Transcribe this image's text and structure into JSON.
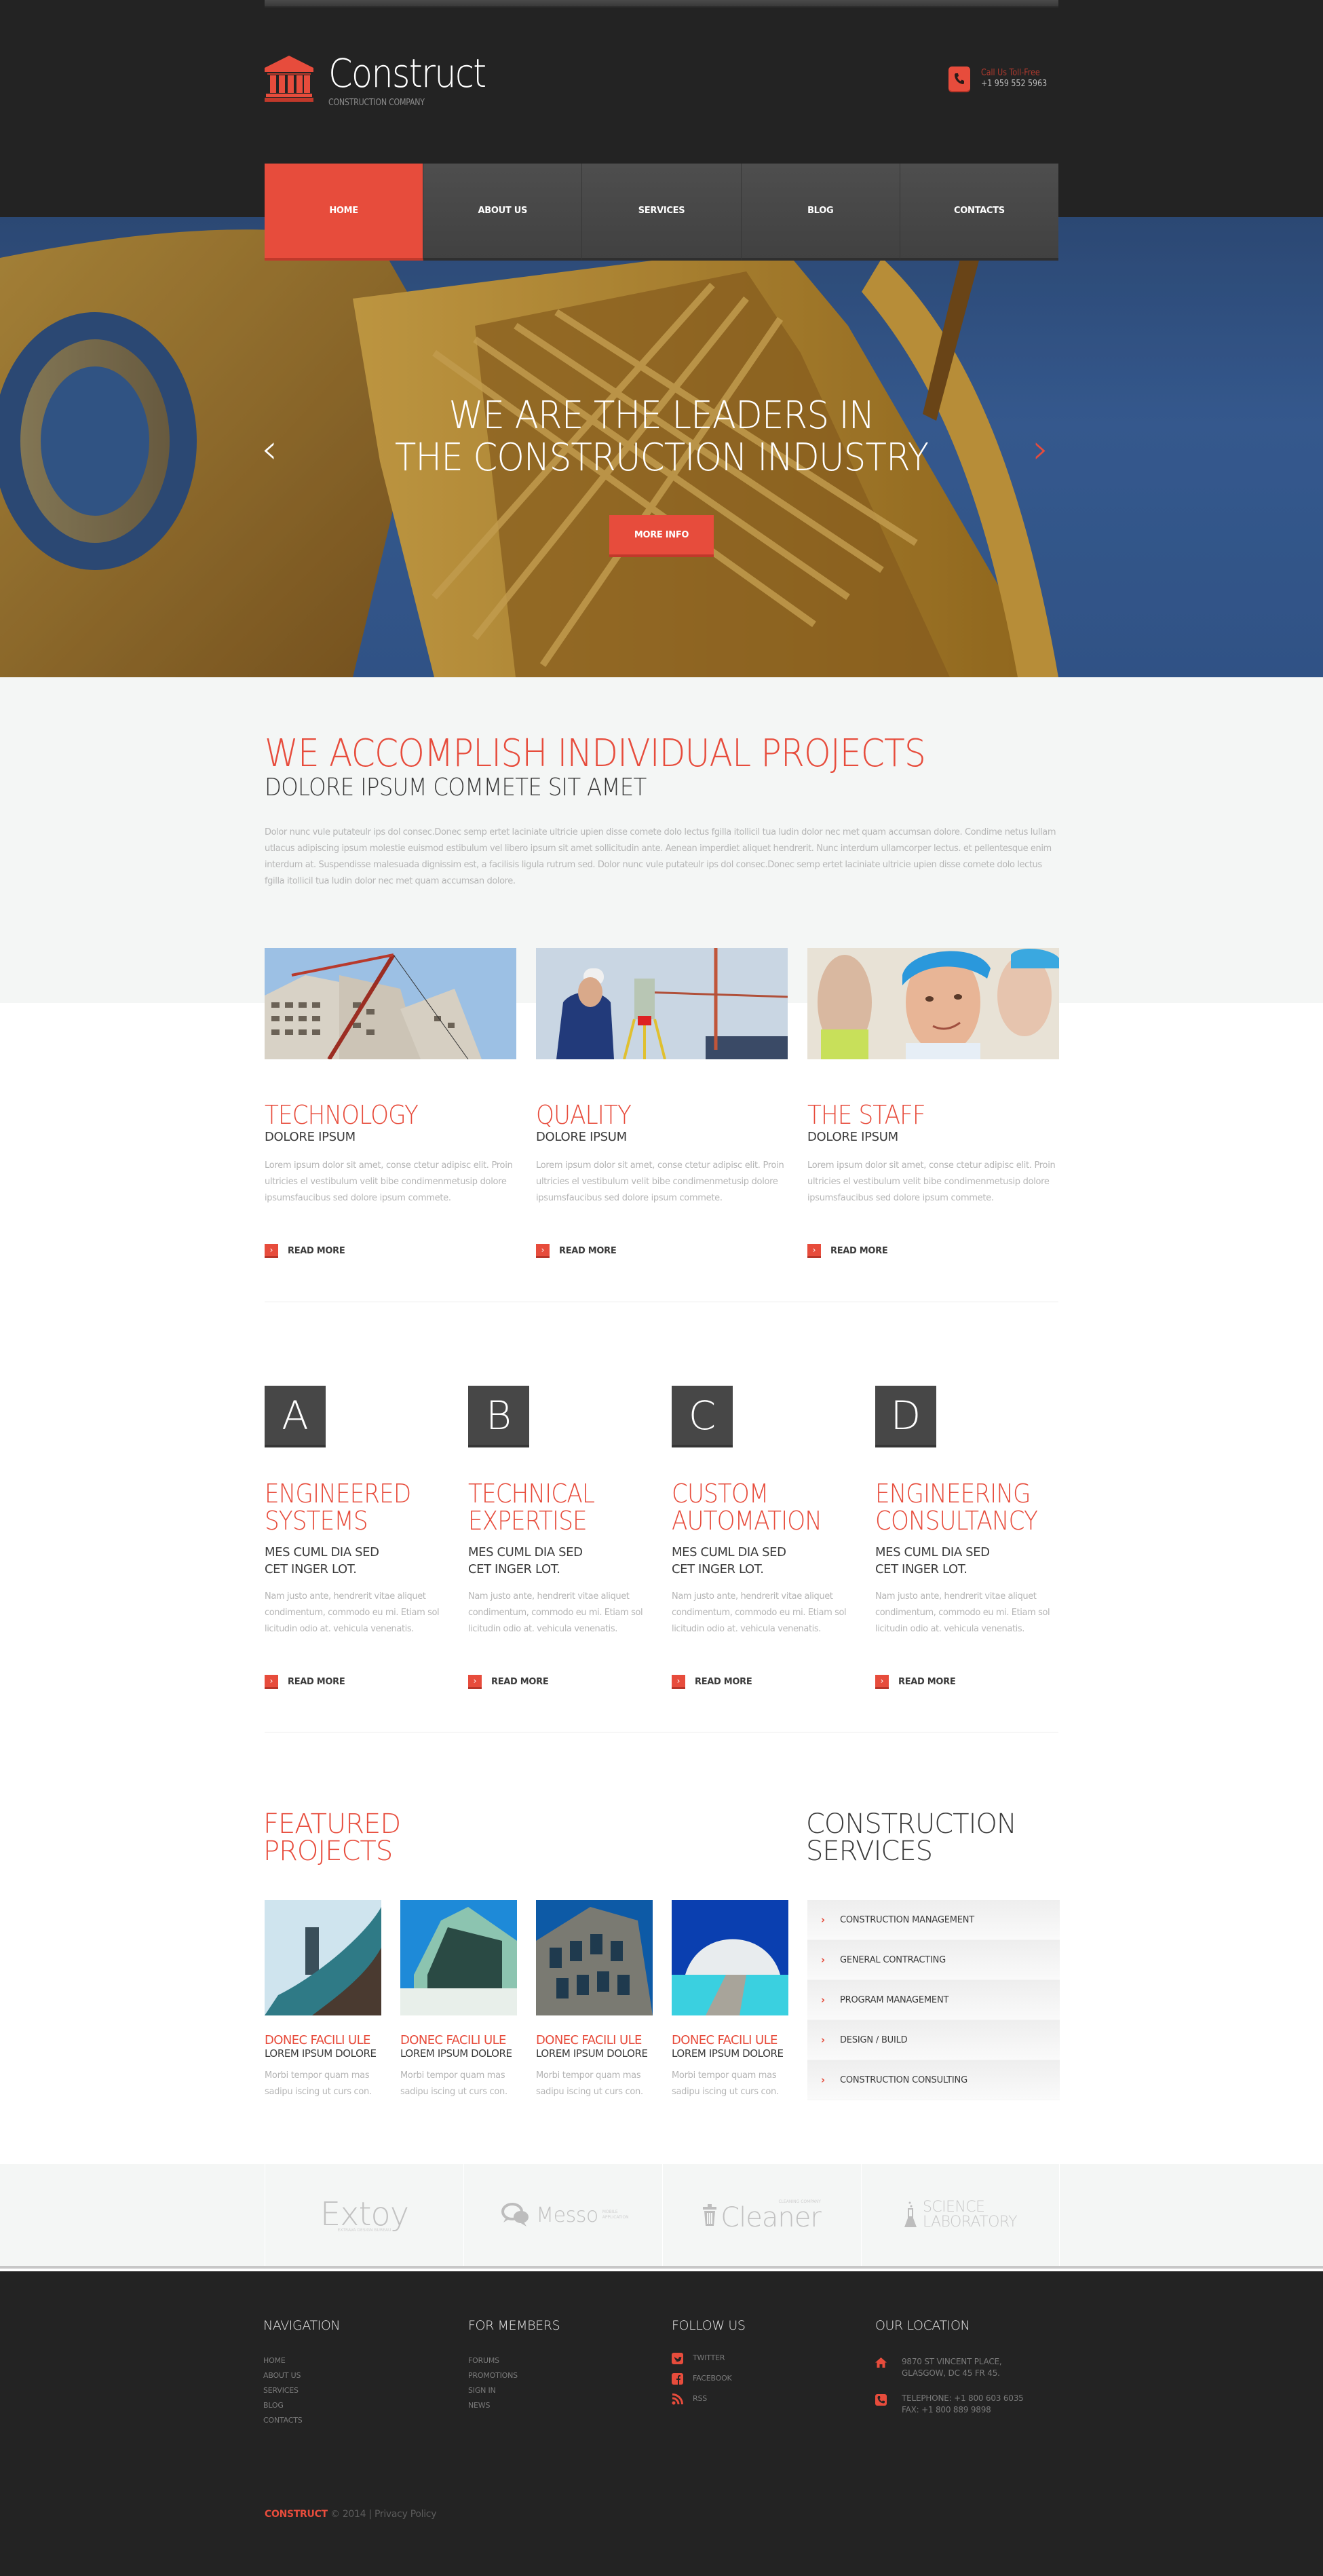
{
  "header": {
    "logo_title": "Construct",
    "logo_subtitle": "CONSTRUCTION COMPANY",
    "phone_label": "Call Us Toll-Free",
    "phone_number": "+1 959 552 5963"
  },
  "nav": {
    "items": [
      {
        "label": "HOME",
        "active": true
      },
      {
        "label": "ABOUT US"
      },
      {
        "label": "SERVICES"
      },
      {
        "label": "BLOG"
      },
      {
        "label": "CONTACTS"
      }
    ]
  },
  "hero": {
    "title_line1": "WE ARE THE LEADERS IN",
    "title_line2": "THE CONSTRUCTION INDUSTRY",
    "button_label": "MORE INFO",
    "prev_arrow": "‹",
    "next_arrow": "›"
  },
  "intro": {
    "title": "WE ACCOMPLISH INDIVIDUAL PROJECTS",
    "subtitle": "DOLORE IPSUM COMMETE SIT AMET",
    "text": "Dolor nunc vule putateulr ips dol consec.Donec semp ertet laciniate ultricie upien disse comete dolo lectus fgilla itollicil tua ludin dolor nec met quam accumsan dolore. Condime netus lullam utlacus adipiscing ipsum molestie euismod estibulum vel libero ipsum sit amet sollicitudin ante. Aenean imperdiet aliquet hendrerit. Nunc interdum ullamcorper lectus. et pellentesque enim interdum at. Suspendisse malesuada dignissim est, a facilisis ligula rutrum sed. Dolor nunc vule putateulr ips dol consec.Donec semp ertet laciniate ultricie upien disse comete dolo lectus fgilla itollicil tua ludin dolor nec met quam accumsan dolore."
  },
  "features": [
    {
      "title": "TECHNOLOGY",
      "subtitle": "DOLORE IPSUM",
      "text": "Lorem ipsum dolor sit amet, conse ctetur adipisc elit. Proin ultricies el vestibulum velit bibe condimenmetusip dolore ipsumsfaucibus sed dolore ipsum commete.",
      "link": "READ MORE"
    },
    {
      "title": "QUALITY",
      "subtitle": "DOLORE IPSUM",
      "text": "Lorem ipsum dolor sit amet, conse ctetur adipisc elit. Proin ultricies el vestibulum velit bibe condimenmetusip dolore ipsumsfaucibus sed dolore ipsum commete.",
      "link": "READ MORE"
    },
    {
      "title": "THE STAFF",
      "subtitle": "DOLORE IPSUM",
      "text": "Lorem ipsum dolor sit amet, conse ctetur adipisc elit. Proin ultricies el vestibulum velit bibe condimenmetusip dolore ipsumsfaucibus sed dolore ipsum commete.",
      "link": "READ MORE"
    }
  ],
  "services": [
    {
      "letter": "A",
      "title1": "ENGINEERED",
      "title2": "SYSTEMS",
      "sub1": "MES CUML DIA SED",
      "sub2": "CET INGER LOT.",
      "text": "Nam justo ante, hendrerit vitae aliquet condimentum, commodo eu mi. Etiam sol licitudin odio at. vehicula venenatis.",
      "link": "READ MORE"
    },
    {
      "letter": "B",
      "title1": "TECHNICAL",
      "title2": "EXPERTISE",
      "sub1": "MES CUML DIA SED",
      "sub2": "CET INGER LOT.",
      "text": "Nam justo ante, hendrerit vitae aliquet condimentum, commodo eu mi. Etiam sol licitudin odio at. vehicula venenatis.",
      "link": "READ MORE"
    },
    {
      "letter": "C",
      "title1": "CUSTOM",
      "title2": "AUTOMATION",
      "sub1": "MES CUML DIA SED",
      "sub2": "CET INGER LOT.",
      "text": "Nam justo ante, hendrerit vitae aliquet condimentum, commodo eu mi. Etiam sol licitudin odio at. vehicula venenatis.",
      "link": "READ MORE"
    },
    {
      "letter": "D",
      "title1": "ENGINEERING",
      "title2": "CONSULTANCY",
      "sub1": "MES CUML DIA SED",
      "sub2": "CET INGER LOT.",
      "text": "Nam justo ante, hendrerit vitae aliquet condimentum, commodo eu mi. Etiam sol licitudin odio at. vehicula venenatis.",
      "link": "READ MORE"
    }
  ],
  "featured": {
    "title1": "FEATURED",
    "title2": "PROJECTS",
    "projects": [
      {
        "title": "DONEC FACILI ULE",
        "subtitle": "LOREM IPSUM DOLORE",
        "text": "Morbi tempor quam mas sadipu iscing ut curs con."
      },
      {
        "title": "DONEC FACILI ULE",
        "subtitle": "LOREM IPSUM DOLORE",
        "text": "Morbi tempor quam mas sadipu iscing ut curs con."
      },
      {
        "title": "DONEC FACILI ULE",
        "subtitle": "LOREM IPSUM DOLORE",
        "text": "Morbi tempor quam mas sadipu iscing ut curs con."
      },
      {
        "title": "DONEC FACILI ULE",
        "subtitle": "LOREM IPSUM DOLORE",
        "text": "Morbi tempor quam mas sadipu iscing ut curs con."
      }
    ]
  },
  "construction_services": {
    "title1": "CONSTRUCTION",
    "title2": "SERVICES",
    "items": [
      "CONSTRUCTION MANAGEMENT",
      "GENERAL CONTRACTING",
      "PROGRAM MANAGEMENT",
      "DESIGN / BUILD",
      "CONSTRUCTION CONSULTING"
    ]
  },
  "partners": [
    {
      "name": "Extoy",
      "tagline": "EXTRAVA DESIGN BUREAU"
    },
    {
      "name": "Messo",
      "tagline": "MOBILE APPLICATION"
    },
    {
      "name": "Cleaner",
      "tagline": "CLEANING COMPANY"
    },
    {
      "name": "SCIENCE",
      "name2": "LABORATORY"
    }
  ],
  "footer": {
    "navigation_title": "NAVIGATION",
    "navigation": [
      "HOME",
      "ABOUT US",
      "SERVICES",
      "BLOG",
      "CONTACTS"
    ],
    "members_title": "FOR MEMBERS",
    "members": [
      "FORUMS",
      "PROMOTIONS",
      "SIGN IN",
      "NEWS"
    ],
    "follow_title": "FOLLOW US",
    "follow": [
      {
        "label": "TWITTER",
        "icon": "twitter-icon"
      },
      {
        "label": "FACEBOOK",
        "icon": "facebook-icon"
      },
      {
        "label": "RSS",
        "icon": "rss-icon"
      }
    ],
    "location_title": "OUR LOCATION",
    "address1": "9870 ST VINCENT PLACE,",
    "address2": "GLASGOW, DC 45 FR 45.",
    "telephone": "TELEPHONE: +1 800 603 6035",
    "fax": "FAX: +1 800 889 9898",
    "copyright_brand": "CONSTRUCT",
    "copyright_year": " © 2014 | ",
    "privacy": "Privacy Policy"
  },
  "colors": {
    "accent": "#e74c3c",
    "dark": "#232323",
    "nav": "#474747"
  }
}
